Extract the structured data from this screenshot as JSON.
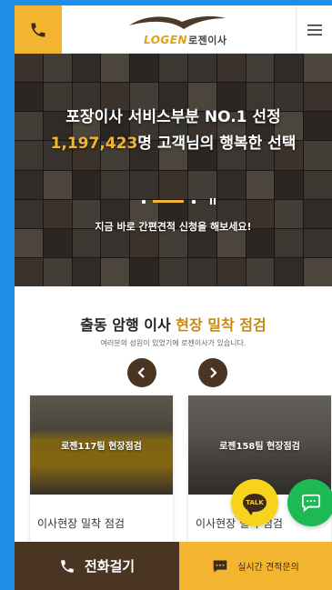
{
  "colors": {
    "frame_bg": "#1e8fe8",
    "accent": "#f3b42f",
    "brown": "#4a3522",
    "kakao": "#f7d31c",
    "chat_green": "#1db954"
  },
  "header": {
    "logo_text": "LOGEN",
    "logo_kr": "로젠이사",
    "call_icon": "phone-icon",
    "menu_icon": "hamburger-menu-icon"
  },
  "hero": {
    "line1": "포장이사 서비스부분 NO.1 선정",
    "count": "1,197,423",
    "line2_rest": "명 고객님의 행복한 선택",
    "sub": "지금 바로 간편견적 신청을 해보세요!"
  },
  "section": {
    "title_a": "출동 암행 이사 ",
    "title_b": "현장 밀착 점검",
    "subtitle": "여러분의 성원이 있었기에 로젠이사가 있습니다."
  },
  "cards": [
    {
      "label": "로젠117팀 현장점검",
      "caption": "이사현장 밀착 점검"
    },
    {
      "label": "로젠158팀 현장점검",
      "caption": "이사현장 밀착 점검"
    }
  ],
  "fab": {
    "talk_label": "TALK"
  },
  "bottom": {
    "call_label": "전화걸기",
    "inquiry_label": "실시간 견적문의"
  }
}
